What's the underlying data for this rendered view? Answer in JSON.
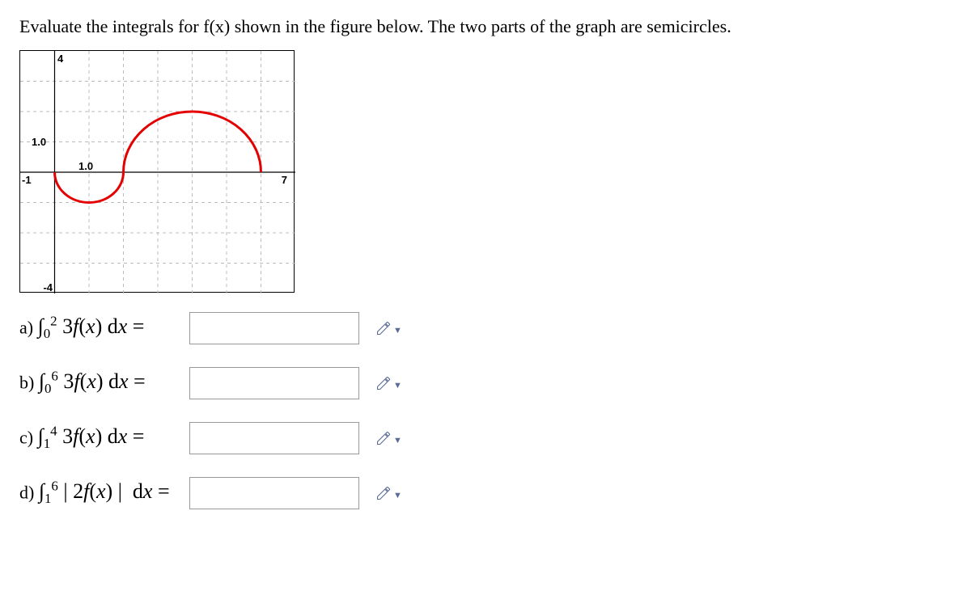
{
  "prompt": "Evaluate the integrals for f(x) shown in the figure below. The two parts of the graph are semicircles.",
  "graph": {
    "x_min": -1,
    "x_max": 7,
    "y_min": -4,
    "y_max": 4,
    "labels": {
      "x_left": "-1",
      "x_right": "7",
      "y_top": "4",
      "y_bottom": "-4",
      "y_mid": "1.0",
      "x_mid": "1.0"
    }
  },
  "questions": {
    "a": {
      "letter": "a)",
      "integral_html": "∫<sub>0</sub><sup>2</sup> 3<i>f</i>(<i>x</i>) d<i>x</i> =",
      "value": ""
    },
    "b": {
      "letter": "b)",
      "integral_html": "∫<sub>0</sub><sup>6</sup> 3<i>f</i>(<i>x</i>) d<i>x</i> =",
      "value": ""
    },
    "c": {
      "letter": "c)",
      "integral_html": "∫<sub>1</sub><sup>4</sup> 3<i>f</i>(<i>x</i>) d<i>x</i> =",
      "value": ""
    },
    "d": {
      "letter": "d)",
      "integral_html": "∫<sub>1</sub><sup>6</sup> | 2<i>f</i>(<i>x</i>) | &nbsp;d<i>x</i> =",
      "value": ""
    }
  },
  "chart_data": {
    "type": "line",
    "title": "",
    "xlabel": "",
    "ylabel": "",
    "xlim": [
      -1,
      7
    ],
    "ylim": [
      -4,
      4
    ],
    "xticks": [
      -1,
      0,
      1,
      2,
      3,
      4,
      5,
      6,
      7
    ],
    "yticks": [
      -4,
      -3,
      -2,
      -1,
      0,
      1,
      2,
      3,
      4
    ],
    "grid": true,
    "series": [
      {
        "name": "f(x)",
        "description": "semicircle radius 1 below x-axis on [0,2], semicircle radius 2 above x-axis on [2,6]",
        "pieces": [
          {
            "shape": "semicircle",
            "center": [
              1,
              0
            ],
            "radius": 1,
            "y_sign": -1,
            "x_interval": [
              0,
              2
            ]
          },
          {
            "shape": "semicircle",
            "center": [
              4,
              0
            ],
            "radius": 2,
            "y_sign": 1,
            "x_interval": [
              2,
              6
            ]
          }
        ],
        "samples_x": [
          0,
          0.5,
          1,
          1.5,
          2,
          2.5,
          3,
          3.5,
          4,
          4.5,
          5,
          5.5,
          6
        ],
        "samples_y": [
          0,
          -0.87,
          -1,
          -0.87,
          0,
          1.32,
          1.73,
          1.94,
          2,
          1.94,
          1.73,
          1.32,
          0
        ]
      }
    ]
  }
}
